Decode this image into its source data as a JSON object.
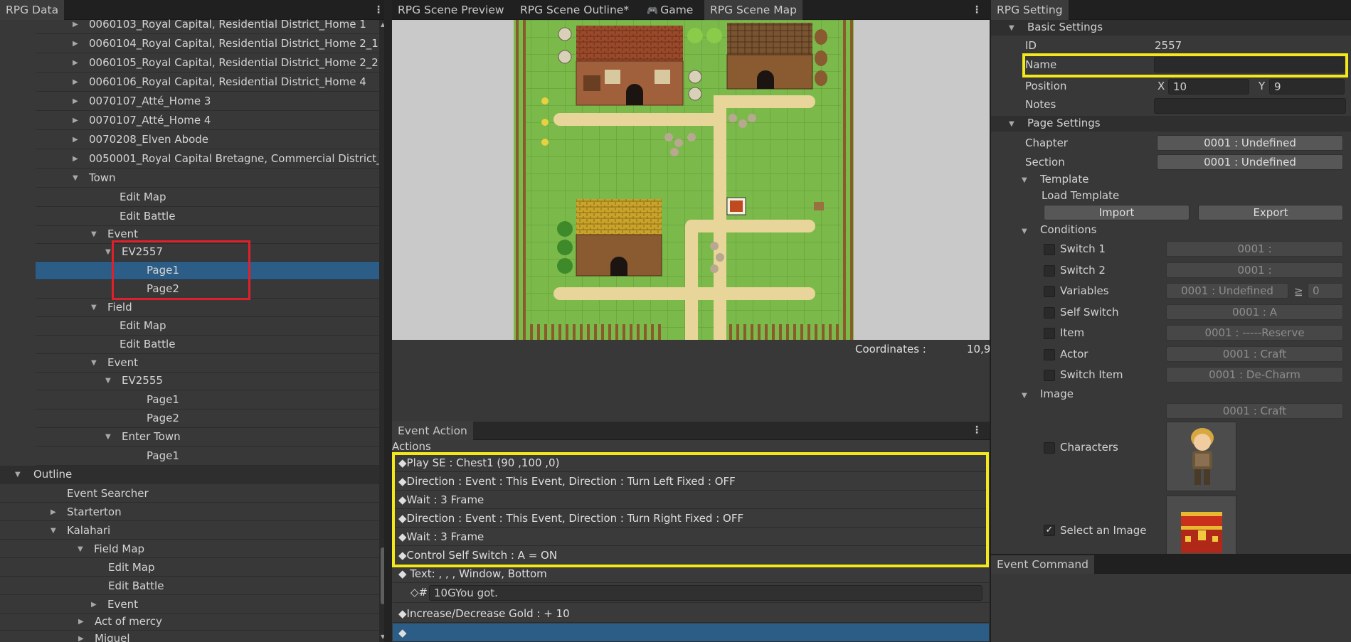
{
  "left_panel": {
    "tab_label": "RPG Data",
    "tree_rows": [
      {
        "label": "0060103_Royal Capital, Residential District_Home 1",
        "triangle": "right"
      },
      {
        "label": "0060104_Royal Capital, Residential District_Home 2_1",
        "triangle": "right"
      },
      {
        "label": "0060105_Royal Capital, Residential District_Home 2_2",
        "triangle": "right"
      },
      {
        "label": "0060106_Royal Capital, Residential District_Home 4",
        "triangle": "right"
      },
      {
        "label": "0070107_Atté_Home 3",
        "triangle": "right"
      },
      {
        "label": "0070107_Atté_Home 4",
        "triangle": "right"
      },
      {
        "label": "0070208_Elven Abode",
        "triangle": "right"
      },
      {
        "label": "0050001_Royal Capital Bretagne, Commercial District_",
        "triangle": "right"
      },
      {
        "label": "Town",
        "triangle": "down"
      },
      {
        "label": "Edit Map",
        "triangle": ""
      },
      {
        "label": "Edit Battle",
        "triangle": ""
      },
      {
        "label": "Event",
        "triangle": "down"
      },
      {
        "label": "EV2557",
        "triangle": "down"
      },
      {
        "label": "Page1",
        "triangle": ""
      },
      {
        "label": "Page2",
        "triangle": ""
      },
      {
        "label": "Field",
        "triangle": "down"
      },
      {
        "label": "Edit Map",
        "triangle": ""
      },
      {
        "label": "Edit Battle",
        "triangle": ""
      },
      {
        "label": "Event",
        "triangle": "down"
      },
      {
        "label": "EV2555",
        "triangle": "down"
      },
      {
        "label": "Page1",
        "triangle": ""
      },
      {
        "label": "Page2",
        "triangle": ""
      },
      {
        "label": "Enter Town",
        "triangle": "down"
      },
      {
        "label": "Page1",
        "triangle": ""
      }
    ],
    "outline_label": "Outline",
    "outline_rows": [
      {
        "label": "Event Searcher",
        "triangle": ""
      },
      {
        "label": "Starterton",
        "triangle": "right"
      },
      {
        "label": "Kalahari",
        "triangle": "down"
      },
      {
        "label": "Field Map",
        "triangle": "down"
      },
      {
        "label": "Edit Map",
        "triangle": ""
      },
      {
        "label": "Edit Battle",
        "triangle": ""
      },
      {
        "label": "Event",
        "triangle": "right"
      },
      {
        "label": "Act of mercy",
        "triangle": "right"
      },
      {
        "label": "Miguel",
        "triangle": "right"
      }
    ]
  },
  "center_tabs": [
    {
      "label": "RPG Scene Preview"
    },
    {
      "label": "RPG Scene Outline*"
    },
    {
      "label": "Game"
    },
    {
      "label": "RPG Scene Map"
    }
  ],
  "map": {
    "coordinates_label": "Coordinates :",
    "coordinates_value": "10,9"
  },
  "event_action": {
    "tab_label": "Event Action",
    "actions_label": "Actions",
    "rows": [
      "◆Play SE : Chest1 (90 ,100 ,0)",
      "◆Direction : Event : This Event, Direction : Turn Left Fixed : OFF",
      "◆Wait : 3 Frame",
      "◆Direction : Event : This Event, Direction : Turn Right Fixed : OFF",
      "◆Wait : 3 Frame",
      "◆Control Self Switch : A = ON",
      "◆ Text: , , , Window, Bottom"
    ],
    "text_sub_prefix": "◇#",
    "text_sub_value": "10GYou got.",
    "gold_row": "◆Increase/Decrease Gold : + 10",
    "last_row": "◆"
  },
  "right_panel": {
    "tab_label": "RPG Setting",
    "basic_settings": "Basic Settings",
    "id_label": "ID",
    "id_value": "2557",
    "name_label": "Name",
    "name_value": "",
    "position_label": "Position",
    "x_label": "X",
    "x_value": "10",
    "y_label": "Y",
    "y_value": "9",
    "notes_label": "Notes",
    "page_settings": "Page Settings",
    "chapter_label": "Chapter",
    "chapter_value": "0001 : Undefined",
    "section_label": "Section",
    "section_value": "0001 : Undefined",
    "template_label": "Template",
    "load_template_label": "Load Template",
    "import_label": "Import",
    "export_label": "Export",
    "conditions_label": "Conditions",
    "conditions": [
      {
        "label": "Switch 1",
        "value": "0001 :"
      },
      {
        "label": "Switch 2",
        "value": "0001 :"
      },
      {
        "label": "Variables",
        "value": "0001 : Undefined"
      },
      {
        "label": "Self Switch",
        "value": "0001 : A"
      },
      {
        "label": "Item",
        "value": "0001 : -----Reserve"
      },
      {
        "label": "Actor",
        "value": "0001 : Craft"
      },
      {
        "label": "Switch Item",
        "value": "0001 : De-Charm"
      }
    ],
    "variables_op": "≧",
    "variables_num": "0",
    "image_label": "Image",
    "image_value": "0001 : Craft",
    "characters_label": "Characters",
    "select_image_label": "Select an Image",
    "select_image_checked": "✓"
  },
  "event_command": {
    "tab_label": "Event Command"
  }
}
